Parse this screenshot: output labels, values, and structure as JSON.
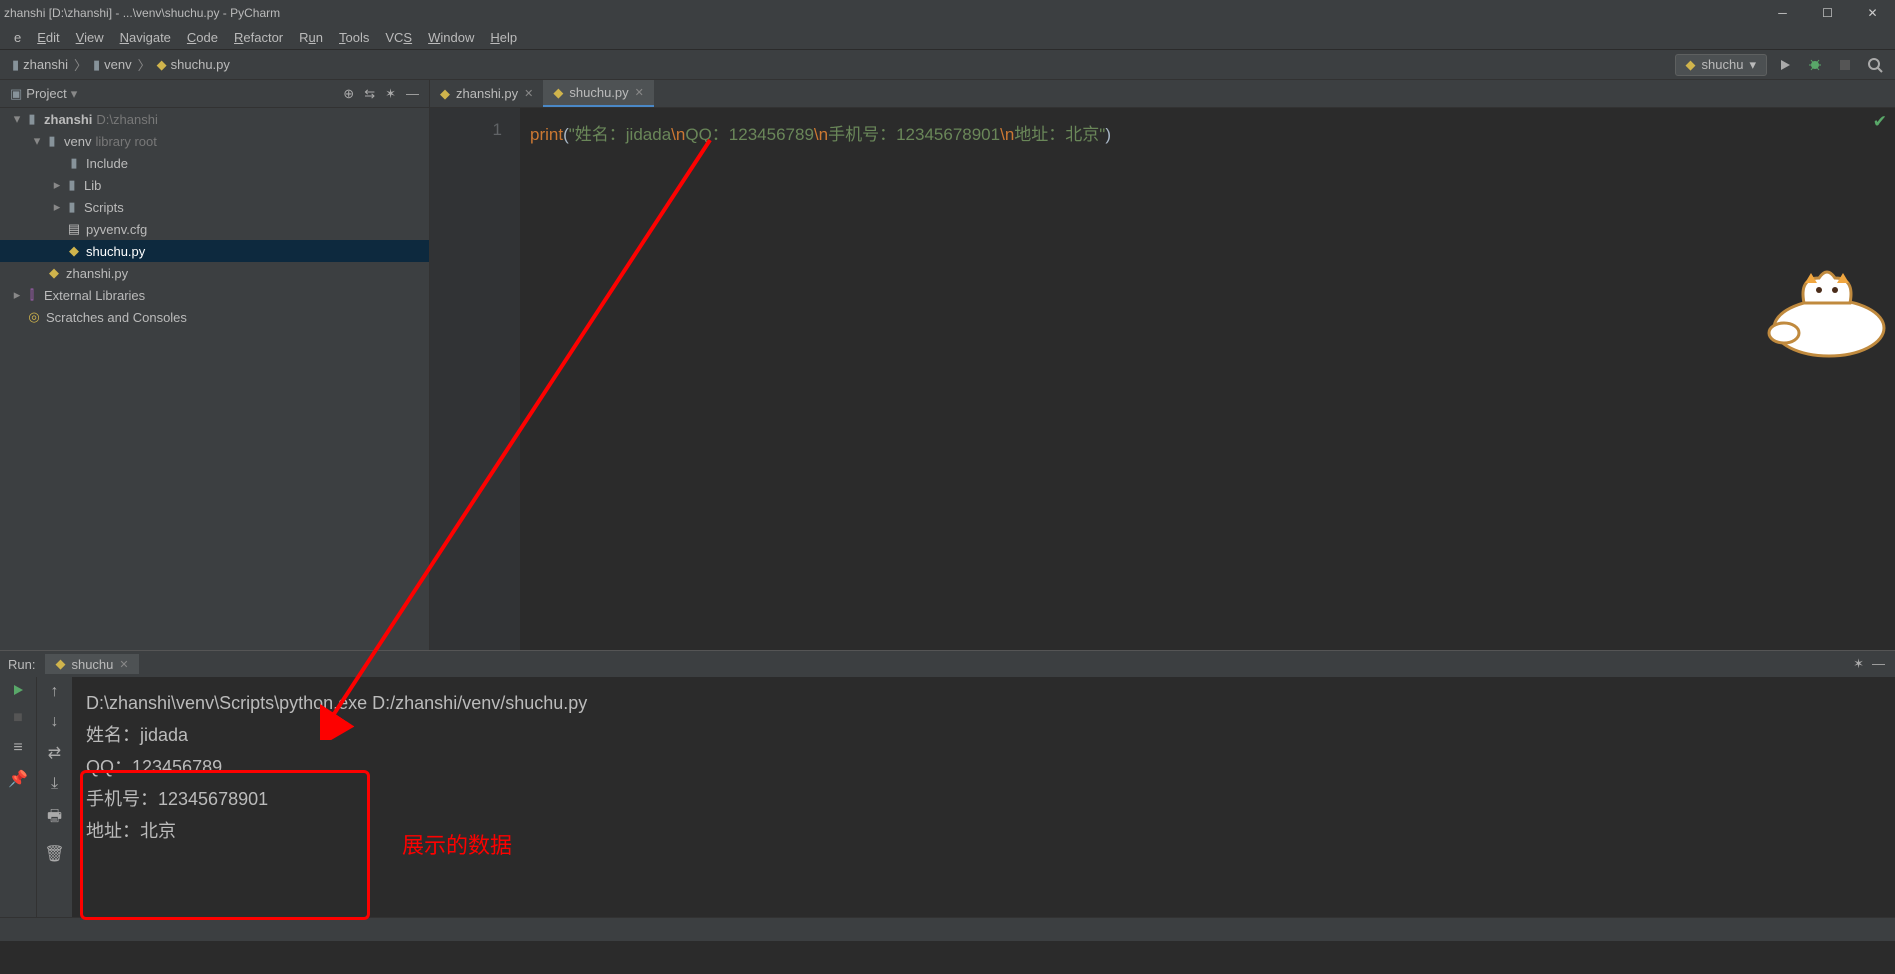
{
  "window": {
    "title": "zhanshi [D:\\zhanshi] - ...\\venv\\shuchu.py - PyCharm"
  },
  "menu": {
    "file": "e",
    "edit": "Edit",
    "view": "View",
    "navigate": "Navigate",
    "code": "Code",
    "refactor": "Refactor",
    "run": "Run",
    "tools": "Tools",
    "vcs": "VCS",
    "window": "Window",
    "help": "Help"
  },
  "breadcrumb": {
    "root": "zhanshi",
    "mid": "venv",
    "file": "shuchu.py"
  },
  "runconfig": {
    "name": "shuchu"
  },
  "project": {
    "panel_title": "Project",
    "root": "zhanshi",
    "root_path": "D:\\zhanshi",
    "venv": "venv",
    "venv_tag": "library root",
    "include": "Include",
    "lib": "Lib",
    "scripts": "Scripts",
    "pyvenv": "pyvenv.cfg",
    "shuchu": "shuchu.py",
    "zhanshi_py": "zhanshi.py",
    "ext_libs": "External Libraries",
    "scratches": "Scratches and Consoles"
  },
  "tabs": {
    "t0": "zhanshi.py",
    "t1": "shuchu.py"
  },
  "code": {
    "line_no": "1",
    "fn": "print",
    "open": "(",
    "s1": "\"姓名：jidada",
    "e1": "\\n",
    "s2": "QQ：123456789",
    "e2": "\\n",
    "s3": "手机号：12345678901",
    "e3": "\\n",
    "s4": "地址：北京\"",
    "close": ")"
  },
  "run": {
    "label": "Run:",
    "tab": "shuchu",
    "cmd": "D:\\zhanshi\\venv\\Scripts\\python.exe D:/zhanshi/venv/shuchu.py",
    "l1": "姓名：jidada",
    "l2": "QQ：123456789",
    "l3": "手机号：12345678901",
    "l4": "地址：北京"
  },
  "annotation": {
    "text": "展示的数据"
  }
}
